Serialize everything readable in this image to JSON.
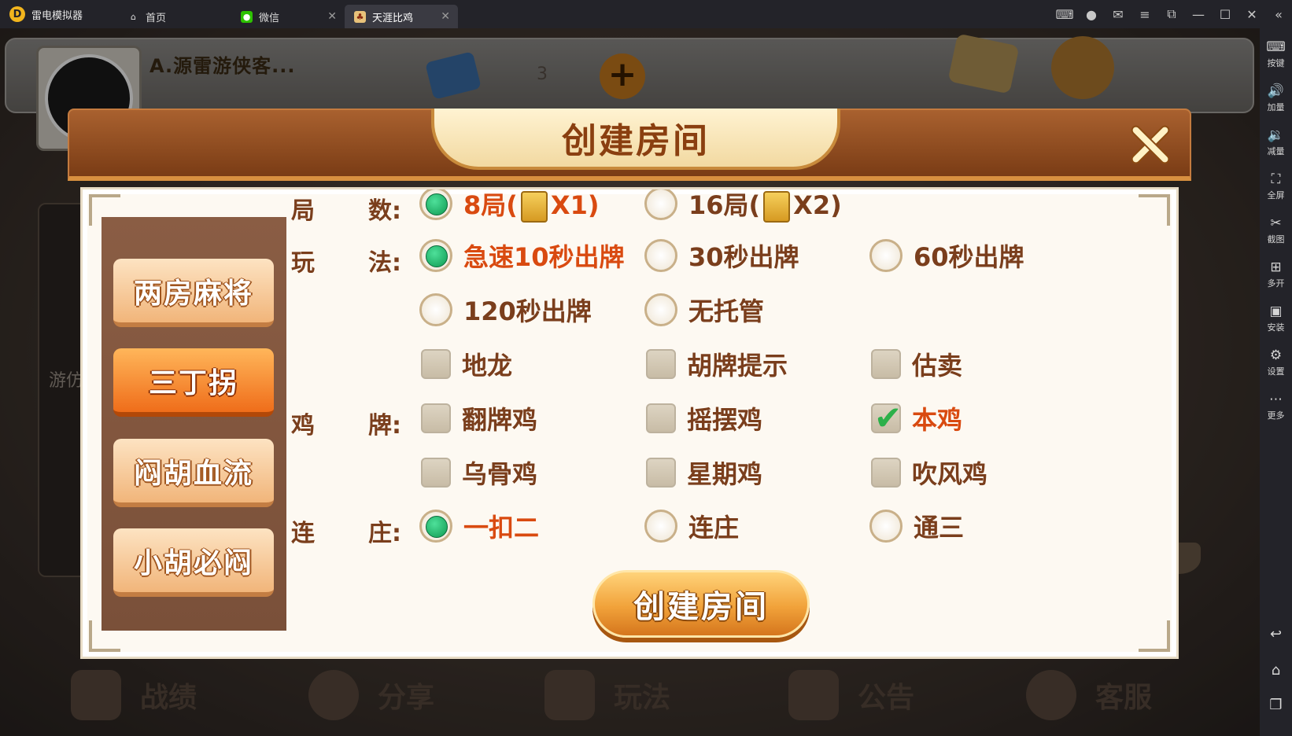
{
  "emulator": {
    "app_name": "雷电模拟器",
    "tabs": [
      {
        "label": "首页",
        "icon": "home-icon"
      },
      {
        "label": "微信",
        "icon": "wechat-icon"
      },
      {
        "label": "天涯比鸡",
        "icon": "game-icon"
      }
    ],
    "sidebar": [
      {
        "label": "按键",
        "icon": "keyboard-icon"
      },
      {
        "label": "加量",
        "icon": "volume-up-icon"
      },
      {
        "label": "减量",
        "icon": "volume-down-icon"
      },
      {
        "label": "全屏",
        "icon": "fullscreen-icon"
      },
      {
        "label": "截图",
        "icon": "scissors-icon"
      },
      {
        "label": "多开",
        "icon": "multi-instance-icon"
      },
      {
        "label": "安装",
        "icon": "apk-icon"
      },
      {
        "label": "设置",
        "icon": "gear-icon"
      },
      {
        "label": "更多",
        "icon": "more-icon"
      }
    ]
  },
  "game": {
    "username": "A.源雷游侠客...",
    "card_count": "3",
    "left_panel_text": "游仿",
    "bottom_nav": [
      {
        "label": "战绩",
        "icon": "trophy-icon"
      },
      {
        "label": "分享",
        "icon": "share-icon"
      },
      {
        "label": "玩法",
        "icon": "rules-icon"
      },
      {
        "label": "公告",
        "icon": "mail-icon"
      },
      {
        "label": "客服",
        "icon": "support-icon"
      }
    ]
  },
  "modal": {
    "title": "创建房间",
    "categories": [
      {
        "label": "两房麻将",
        "active": false
      },
      {
        "label": "三丁拐",
        "active": true
      },
      {
        "label": "闷胡血流",
        "active": false
      },
      {
        "label": "小胡必闷",
        "active": false
      }
    ],
    "rounds": {
      "label_a": "局",
      "label_b": "数:",
      "options": [
        {
          "text": "8局(",
          "multiplier": "X1)",
          "selected": true
        },
        {
          "text": "16局(",
          "multiplier": "X2)",
          "selected": false
        }
      ]
    },
    "play": {
      "label_a": "玩",
      "label_b": "法:",
      "radios": [
        {
          "text": "急速10秒出牌",
          "selected": true
        },
        {
          "text": "30秒出牌",
          "selected": false
        },
        {
          "text": "60秒出牌",
          "selected": false
        },
        {
          "text": "120秒出牌",
          "selected": false
        },
        {
          "text": "无托管",
          "selected": false
        }
      ],
      "checks": [
        {
          "text": "地龙",
          "checked": false
        },
        {
          "text": "胡牌提示",
          "checked": false
        },
        {
          "text": "估卖",
          "checked": false
        }
      ]
    },
    "chicken": {
      "label_a": "鸡",
      "label_b": "牌:",
      "checks": [
        {
          "text": "翻牌鸡",
          "checked": false
        },
        {
          "text": "摇摆鸡",
          "checked": false
        },
        {
          "text": "本鸡",
          "checked": true
        },
        {
          "text": "乌骨鸡",
          "checked": false
        },
        {
          "text": "星期鸡",
          "checked": false
        },
        {
          "text": "吹风鸡",
          "checked": false
        }
      ]
    },
    "dealer": {
      "label_a": "连",
      "label_b": "庄:",
      "options": [
        {
          "text": "一扣二",
          "selected": true
        },
        {
          "text": "连庄",
          "selected": false
        },
        {
          "text": "通三",
          "selected": false
        }
      ]
    },
    "create_button": "创建房间"
  }
}
